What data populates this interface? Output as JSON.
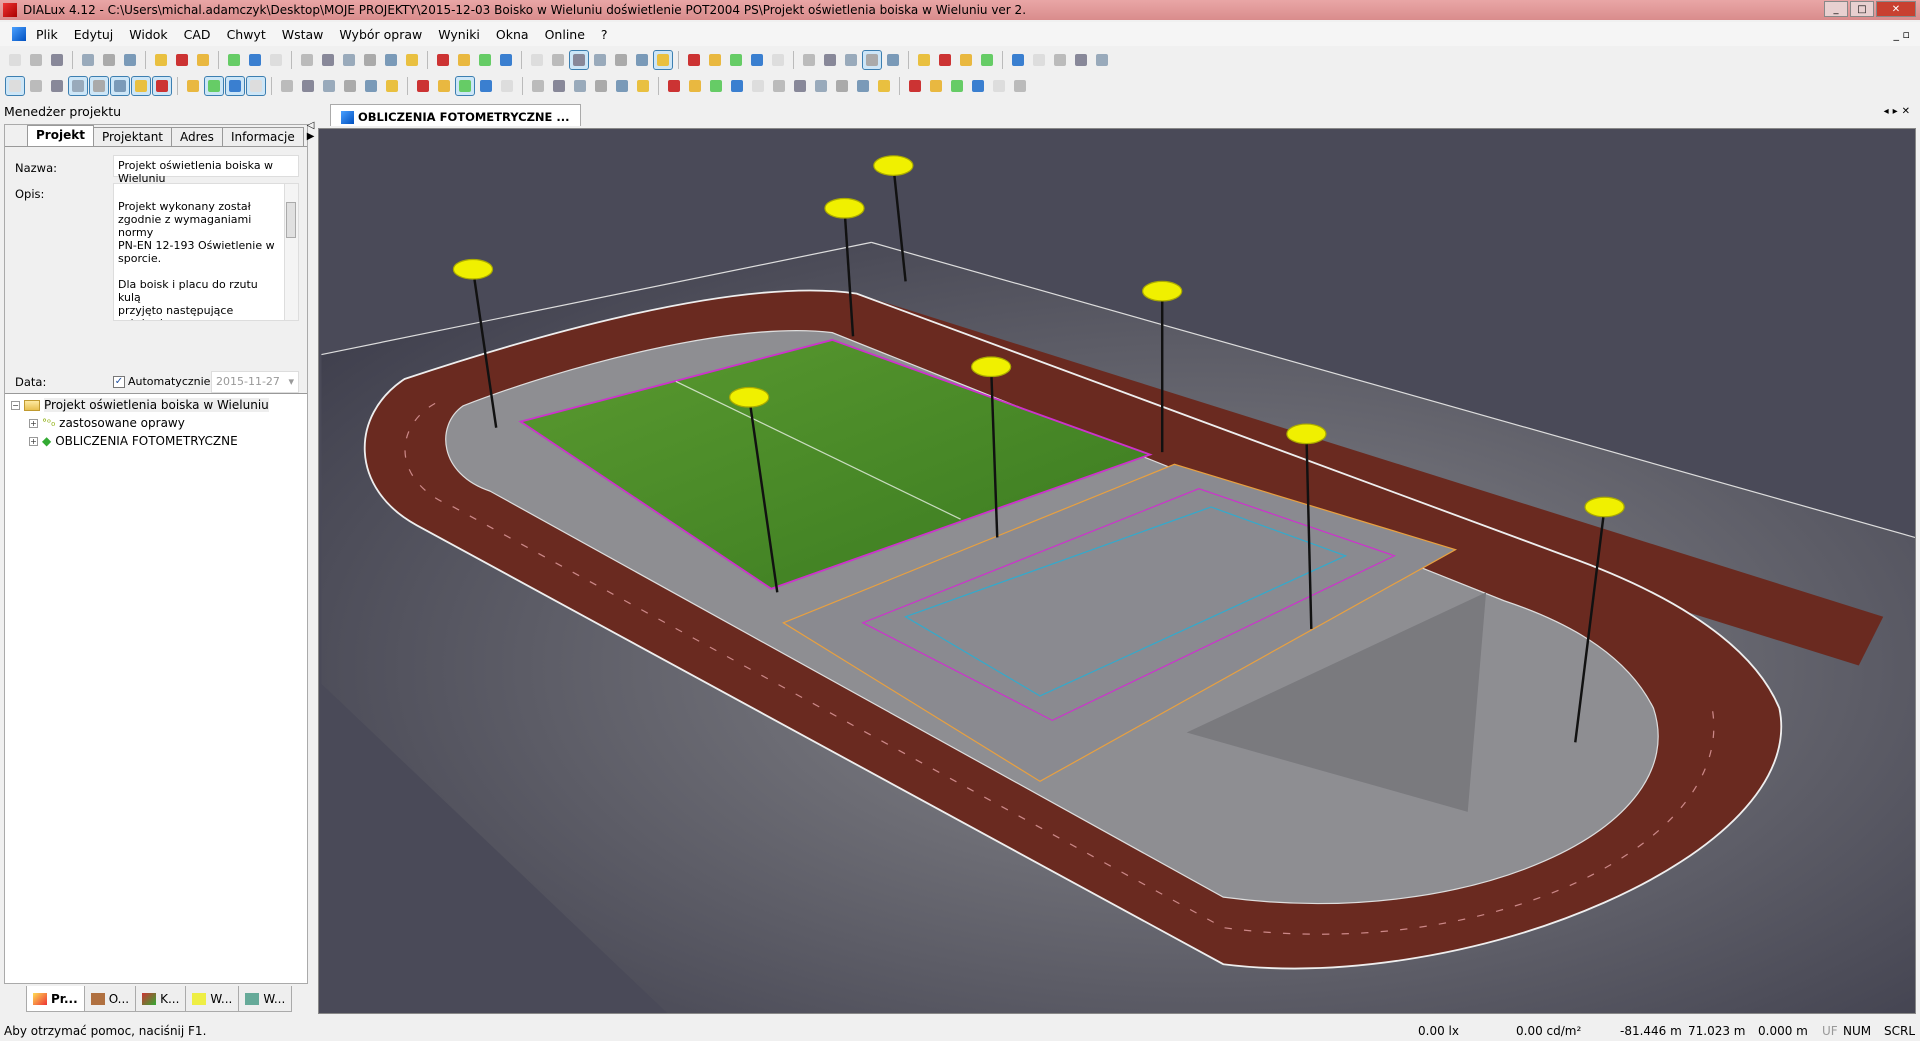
{
  "window": {
    "title": "DIALux 4.12 - C:\\Users\\michal.adamczyk\\Desktop\\MOJE PROJEKTY\\2015-12-03 Boisko w Wieluniu  doświetlenie POT2004 PS\\Projekt oświetlenia boiska w Wieluniu ver 2."
  },
  "menu": [
    {
      "label": "Plik"
    },
    {
      "label": "Edytuj"
    },
    {
      "label": "Widok"
    },
    {
      "label": "CAD"
    },
    {
      "label": "Chwyt"
    },
    {
      "label": "Wstaw"
    },
    {
      "label": "Wybór opraw"
    },
    {
      "label": "Wyniki"
    },
    {
      "label": "Okna"
    },
    {
      "label": "Online"
    },
    {
      "label": "?"
    }
  ],
  "project_manager": {
    "title": "Menedżer projektu",
    "tabs": [
      "Projekt",
      "Projektant",
      "Adres",
      "Informacje"
    ],
    "active_tab": "Projekt",
    "name_label": "Nazwa:",
    "name_value": "Projekt oświetlenia boiska w Wieluniu",
    "desc_label": "Opis:",
    "desc_value": "Projekt wykonany został\nzgodnie z wymaganiami normy\nPN-EN 12-193 Oświetlenie w\nsporcie.\n\nDla boisk i placu do rzutu kulą\nprzyjęto następujące założenia\nprojektowe dla III klasy\noświetleniowej:\nŚrednie natężenie oświetlenia",
    "date_label": "Data:",
    "auto_label": "Automatycznie",
    "auto_checked": true,
    "date_value": "2015-11-27",
    "tree": {
      "root": "Projekt oświetlenia boiska w Wieluniu",
      "children": [
        "zastosowane oprawy",
        "OBLICZENIA FOTOMETRYCZNE"
      ]
    },
    "bottom_tabs": [
      "Pr...",
      "O...",
      "K...",
      "W...",
      "W..."
    ]
  },
  "document_tab": "OBLICZENIA FOTOMETRYCZNE ...",
  "status": {
    "help": "Aby otrzymać pomoc, naciśnij F1.",
    "illuminance": "0.00 lx",
    "luminance": "0.00 cd/m²",
    "x": "-81.446 m",
    "y": "71.023 m",
    "z": "0.000 m",
    "uf": "UF",
    "num": "NUM",
    "scrl": "SCRL"
  },
  "colors": {
    "track": "#6a2a20",
    "field": "#4a8a2a",
    "viewport_bg": "#4a4a58",
    "lamp": "#f0f000"
  }
}
